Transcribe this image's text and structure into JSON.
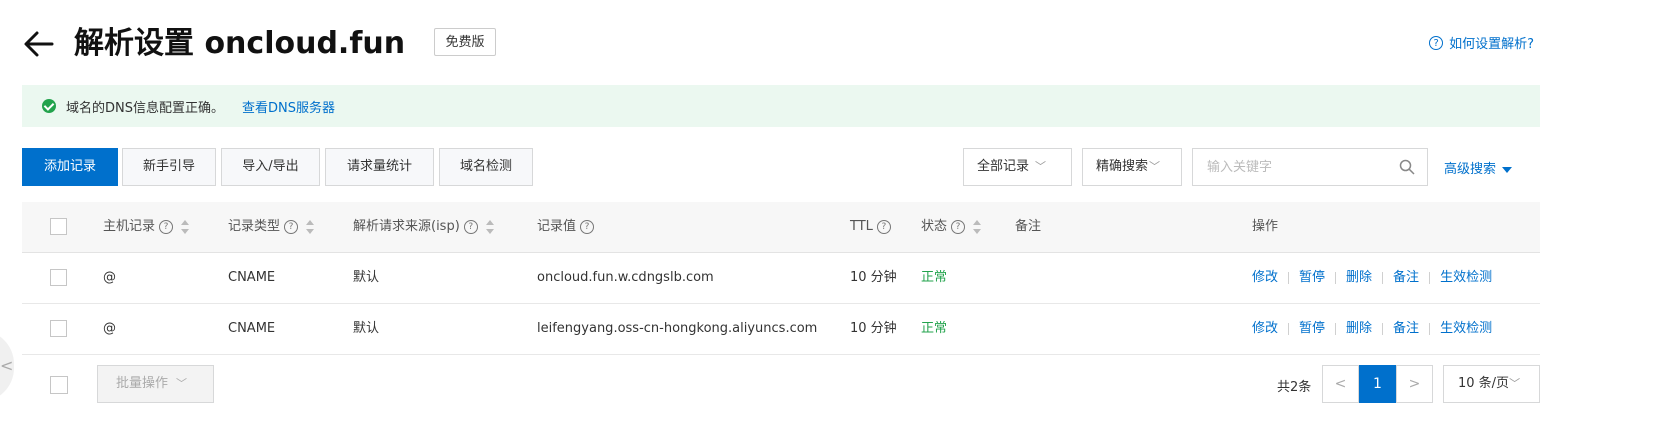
{
  "header": {
    "title": "解析设置 oncloud.fun",
    "edition_badge": "免费版",
    "help_label": "如何设置解析?"
  },
  "notice": {
    "message": "域名的DNS信息配置正确。",
    "link": "查看DNS服务器",
    "status_color": "#23a34d"
  },
  "toolbar": {
    "add_record": "添加记录",
    "beginner_guide": "新手引导",
    "import_export": "导入/导出",
    "request_stats": "请求量统计",
    "domain_check": "域名检测",
    "record_filter": "全部记录",
    "search_mode": "精确搜索",
    "search_placeholder": "输入关键字",
    "advanced_search": "高级搜索"
  },
  "table": {
    "columns": {
      "host": "主机记录",
      "type": "记录类型",
      "source": "解析请求来源(isp)",
      "value": "记录值",
      "ttl": "TTL",
      "status": "状态",
      "remark": "备注",
      "actions": "操作"
    },
    "rows": [
      {
        "host": "@",
        "type": "CNAME",
        "source": "默认",
        "value": "oncloud.fun.w.cdngslb.com",
        "ttl": "10 分钟",
        "status": "正常",
        "remark": "",
        "actions": [
          "修改",
          "暂停",
          "删除",
          "备注",
          "生效检测"
        ]
      },
      {
        "host": "@",
        "type": "CNAME",
        "source": "默认",
        "value": "leifengyang.oss-cn-hongkong.aliyuncs.com",
        "ttl": "10 分钟",
        "status": "正常",
        "remark": "",
        "actions": [
          "修改",
          "暂停",
          "删除",
          "备注",
          "生效检测"
        ]
      }
    ]
  },
  "footer": {
    "batch_label": "批量操作",
    "total": "共2条",
    "current_page": "1",
    "page_size": "10 条/页"
  },
  "colors": {
    "primary": "#0070cc",
    "success": "#23a34d",
    "notice_bg": "#ebf8f0"
  }
}
